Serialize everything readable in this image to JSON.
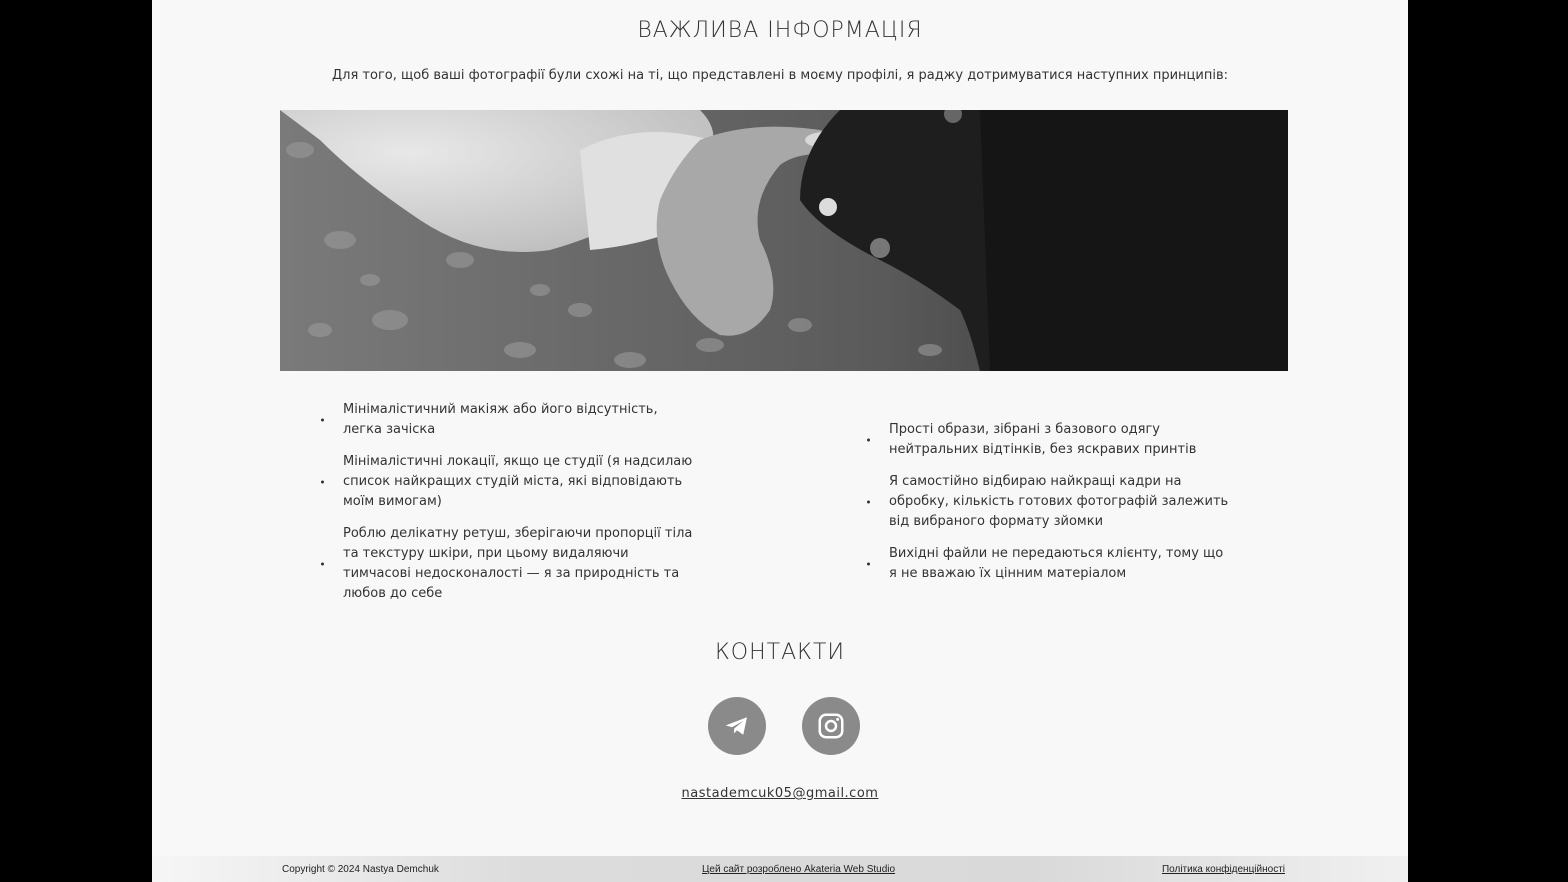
{
  "info": {
    "title": "ВАЖЛИВА ІНФОРМАЦІЯ",
    "intro": "Для того, щоб ваші фотографії були схожі на ті, що представлені в моєму профілі, я раджу дотримуватися наступних принципів:"
  },
  "principles_left": [
    "Мінімалістичний макіяж або його відсутність, легка зачіска",
    "Мінімалістичні локації, якщо це студії (я надсилаю список найкращих студій міста, які відповідають моїм вимогам)",
    "Роблю делікатну ретуш, зберігаючи пропорції тіла та текстуру шкіри, при цьому видаляючи тимчасові недосконалості — я за природність та любов до себе"
  ],
  "principles_right": [
    "Прості образи, зібрані з базового одягу нейтральних відтінків, без яскравих принтів",
    "Я самостійно відбираю найкращі кадри на обробку, кількість готових фотографій залежить від вибраного формату зйомки",
    "Вихідні файли не передаються клієнту, тому що я не вважаю їх цінним матеріалом"
  ],
  "contacts": {
    "title": "КОНТАКТИ",
    "telegram_icon": "telegram-icon",
    "instagram_icon": "instagram-icon",
    "email": "nastademcuk05@gmail.com"
  },
  "footer": {
    "copyright": "Copyright © 2024 Nastya Demchuk",
    "developer": "Цей сайт розроблено Akateria Web Studio",
    "privacy": "Політика конфіденційності"
  },
  "colors": {
    "page_bg": "#f8f8f8",
    "outer_bg": "#000000",
    "icon_bg": "#8a8a8a"
  }
}
